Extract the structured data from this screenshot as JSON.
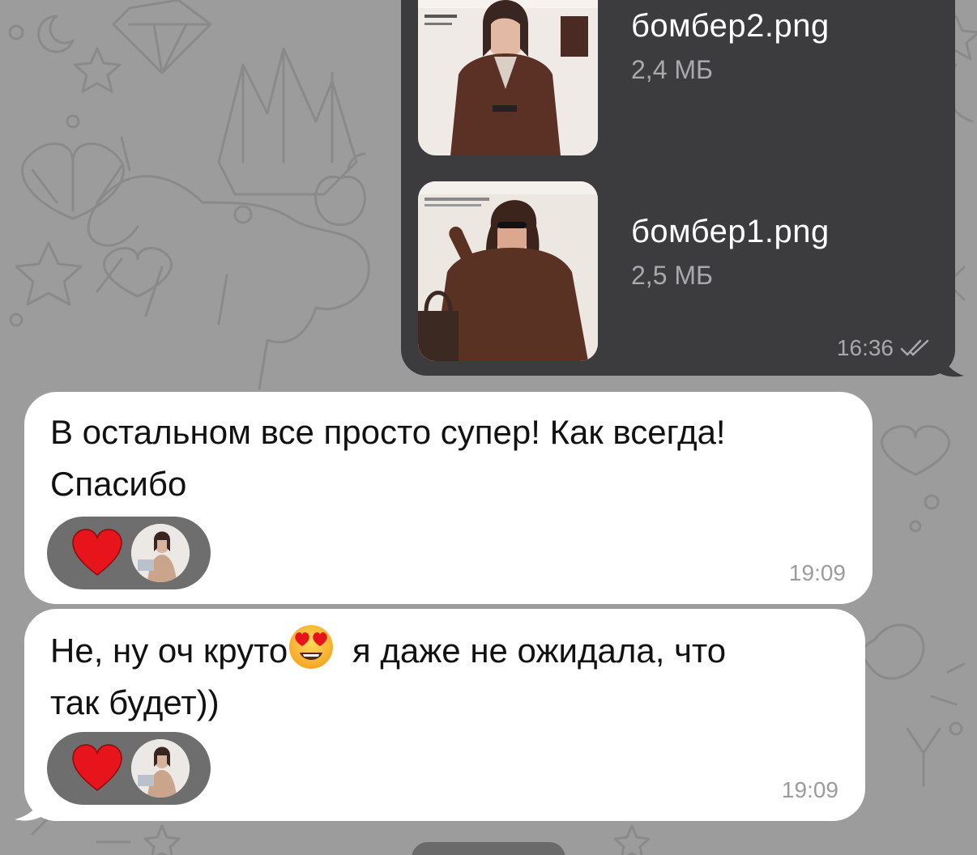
{
  "chat": {
    "background_color": "#9c9c9c",
    "outgoing": {
      "files": [
        {
          "name": "бомбер2.png",
          "size": "2,4 МБ",
          "thumb_icon": "jacket-photo-2"
        },
        {
          "name": "бомбер1.png",
          "size": "2,5 МБ",
          "thumb_icon": "jacket-photo-1"
        }
      ],
      "time": "16:36",
      "status_icon": "double-check-icon"
    },
    "incoming": [
      {
        "line1": "В остальном все просто супер! Как всегда!",
        "line2": "Спасибо",
        "time": "19:09",
        "reaction_icon": "heart-icon"
      },
      {
        "line1_before_emoji": "Не, ну оч круто",
        "emoji_icon": "heart-eyes-emoji",
        "line1_after_emoji": " я даже не ожидала, что",
        "line2": "так будет))",
        "time": "19:09",
        "reaction_icon": "heart-icon"
      }
    ],
    "colors": {
      "outgoing_bubble": "#3c3c3e",
      "incoming_bubble": "#ffffff",
      "reaction_pill": "#6e6e6e",
      "heart": "#e8141b"
    }
  }
}
